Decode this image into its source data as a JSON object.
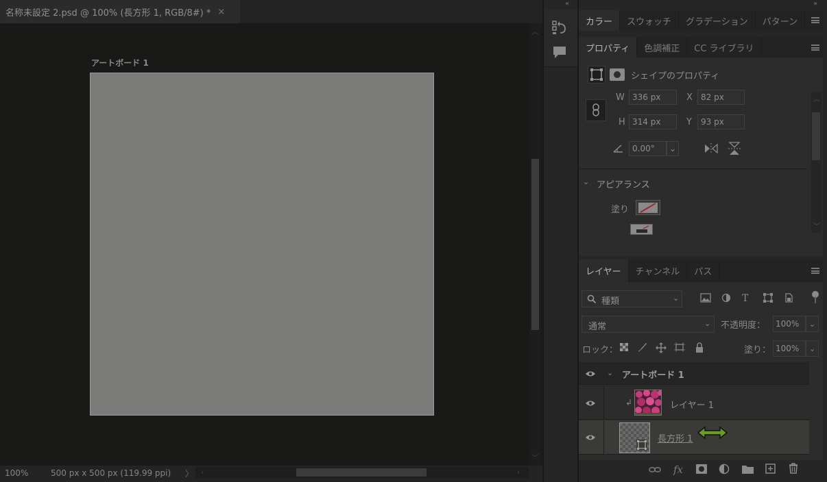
{
  "document": {
    "tab_title": "名称未設定 2.psd @ 100% (長方形 1, RGB/8#) *",
    "close_glyph": "×",
    "artboard_label": "アートボード 1",
    "canvas_color": "#7b7b79"
  },
  "statusbar": {
    "zoom": "100%",
    "info": "500 px x 500 px (119.99 ppi)",
    "arrow": "〉"
  },
  "panels": {
    "color_group_tabs": [
      "カラー",
      "スウォッチ",
      "グラデーション",
      "パターン"
    ],
    "properties_tabs": [
      "プロパティ",
      "色調補正",
      "CC ライブラリ"
    ],
    "shape_properties_title": "シェイプのプロパティ",
    "transform": {
      "w_label": "W",
      "w_value": "336 px",
      "x_label": "X",
      "x_value": "82 px",
      "h_label": "H",
      "h_value": "314 px",
      "y_label": "Y",
      "y_value": "93 px",
      "angle_value": "0.00°"
    },
    "appearance": {
      "title": "アピアランス",
      "fill_label": "塗り"
    },
    "layers_tabs": [
      "レイヤー",
      "チャンネル",
      "パス"
    ],
    "filter_kind": "種類",
    "blend_mode": "通常",
    "opacity_label": "不透明度：",
    "opacity_value": "100%",
    "lock_label": "ロック：",
    "fill_label": "塗り：",
    "fill_value": "100%",
    "layers": [
      {
        "name": "アートボード 1",
        "type": "artboard"
      },
      {
        "name": "レイヤー 1",
        "type": "image",
        "clipped": true
      },
      {
        "name": "長方形 1",
        "type": "shape",
        "selected": true
      }
    ]
  },
  "colors": {
    "accent_arrow": "#6b9a2a",
    "selected_row": "#3a3a36"
  }
}
